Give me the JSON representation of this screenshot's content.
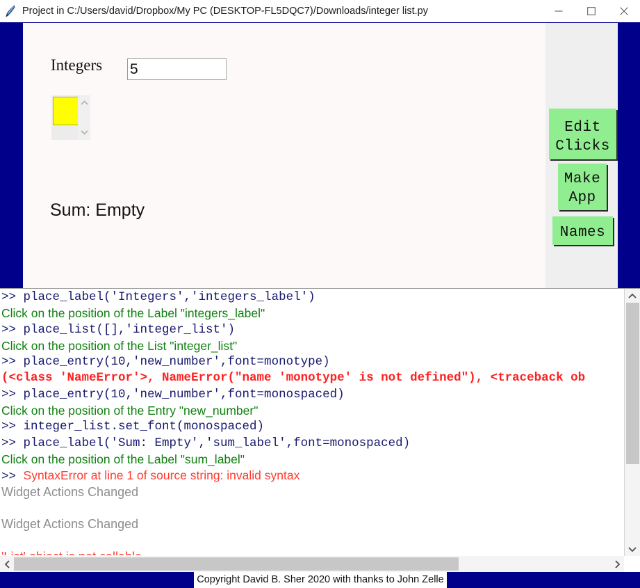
{
  "window": {
    "title": "Project in C:/Users/david/Dropbox/My PC (DESKTOP-FL5DQC7)/Downloads/integer list.py",
    "icon": "python-feather-icon",
    "controls": {
      "minimize": "minimize-icon",
      "maximize": "maximize-icon",
      "close": "close-icon"
    }
  },
  "colors": {
    "frame_blue": "#00008b",
    "canvas_bg": "#fdf9f8",
    "panel_bg": "#efeff0",
    "button_green": "#90ee90",
    "selection_yellow": "#ffff00",
    "console_green": "#108010",
    "console_red": "#ff3b30",
    "console_error": "#ff2020",
    "console_prompt": "#16186e",
    "console_gray": "#8d8d8d"
  },
  "designer": {
    "integers_label": "Integers",
    "entry": {
      "value": "5",
      "placeholder": ""
    },
    "listbox": {
      "items": [
        ""
      ],
      "selected_index": 0,
      "scroll_up": "chevron-up-icon",
      "scroll_down": "chevron-down-icon"
    },
    "sum_label": "Sum: Empty",
    "buttons": [
      {
        "id": "edit-clicks",
        "label": "Edit\nClicks"
      },
      {
        "id": "make-app",
        "label": "Make\nApp"
      },
      {
        "id": "names",
        "label": "Names"
      }
    ],
    "button_labels": {
      "edit_clicks_line1": "Edit",
      "edit_clicks_line2": "Clicks",
      "make_app_line1": "Make",
      "make_app_line2": "App",
      "names": "Names"
    }
  },
  "console": {
    "lines": [
      {
        "kind": "mono",
        "text": ">> place_label('Integers','integers_label')"
      },
      {
        "kind": "green",
        "text": "Click on the position of the Label \"integers_label\""
      },
      {
        "kind": "mono",
        "text": ">> place_list([],'integer_list')"
      },
      {
        "kind": "green",
        "text": "Click on the position of the List \"integer_list\""
      },
      {
        "kind": "mono",
        "text": ">> place_entry(10,'new_number',font=monotype)"
      },
      {
        "kind": "err",
        "text": "(<class 'NameError'>, NameError(\"name 'monotype' is not defined\"), <traceback ob"
      },
      {
        "kind": "mono",
        "text": ">> place_entry(10,'new_number',font=monospaced)"
      },
      {
        "kind": "green",
        "text": "Click on the position of the Entry \"new_number\""
      },
      {
        "kind": "mono",
        "text": ">> integer_list.set_font(monospaced)"
      },
      {
        "kind": "mono",
        "text": ">> place_label('Sum: Empty','sum_label',font=monospaced)"
      },
      {
        "kind": "green",
        "text": "Click on the position of the Label \"sum_label\""
      },
      {
        "kind": "mixed",
        "prompt": ">> ",
        "text": "SyntaxError at line 1 of source string: invalid syntax"
      },
      {
        "kind": "gray",
        "text": "Widget Actions Changed"
      },
      {
        "kind": "blank",
        "text": ""
      },
      {
        "kind": "gray",
        "text": "Widget Actions Changed"
      },
      {
        "kind": "blank",
        "text": ""
      },
      {
        "kind": "red",
        "text": "'List' object is not callable"
      }
    ],
    "vscrollbar": {
      "up": "scroll-up-icon",
      "down": "scroll-down-icon"
    },
    "hscrollbar": {
      "left": "scroll-left-icon",
      "right": "scroll-right-icon"
    }
  },
  "statusbar": {
    "copyright": "Copyright David B. Sher 2020 with thanks to John Zelle"
  }
}
